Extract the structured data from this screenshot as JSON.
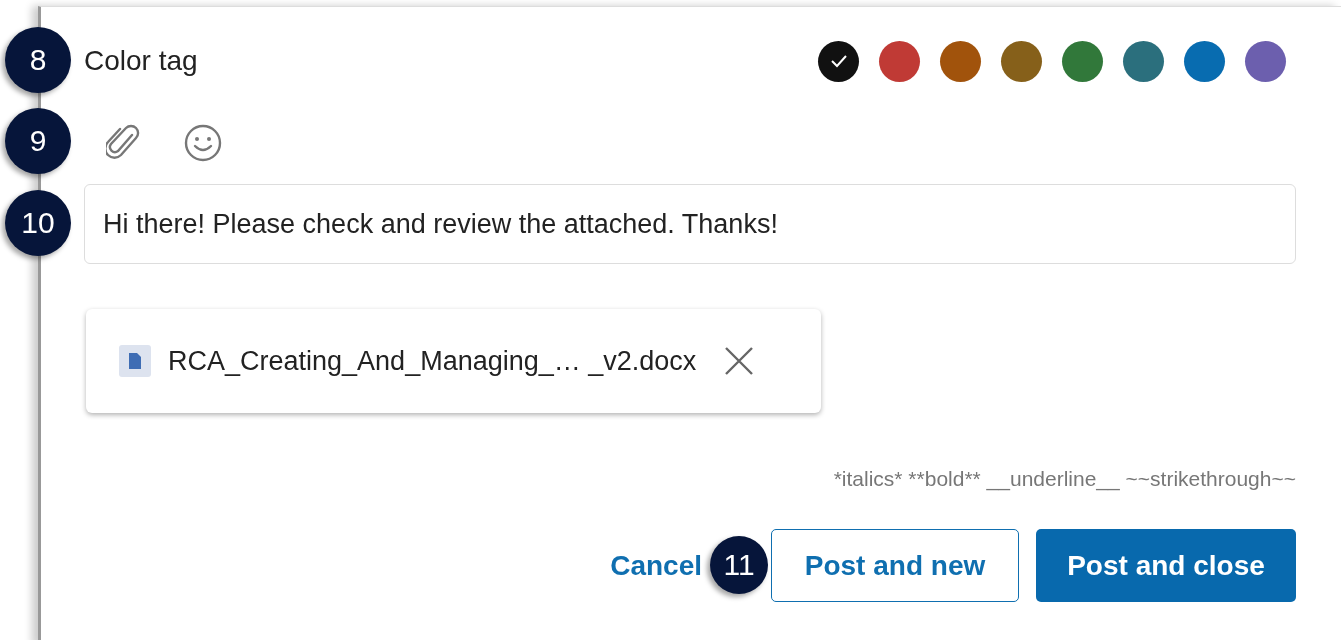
{
  "color_tag": {
    "label": "Color tag",
    "colors": [
      {
        "color": "#111111",
        "selected": true
      },
      {
        "color": "#c03a35",
        "selected": false
      },
      {
        "color": "#a1530c",
        "selected": false
      },
      {
        "color": "#86601a",
        "selected": false
      },
      {
        "color": "#31783a",
        "selected": false
      },
      {
        "color": "#2b6f7d",
        "selected": false
      },
      {
        "color": "#086cb0",
        "selected": false
      },
      {
        "color": "#6c5fae",
        "selected": false
      }
    ]
  },
  "message": {
    "value": "Hi there! Please check and review the attached. Thanks!"
  },
  "attachment": {
    "name": "RCA_Creating_And_Managing_… _v2.docx"
  },
  "format_hint": "*italics* **bold** __underline__ ~~strikethrough~~",
  "buttons": [
    {
      "kind": "link",
      "label": "Cancel"
    },
    {
      "kind": "secondary",
      "label": "Post and new"
    },
    {
      "kind": "primary",
      "label": "Post and close"
    }
  ],
  "callouts": [
    {
      "label": "8"
    },
    {
      "label": "9"
    },
    {
      "label": "10"
    },
    {
      "label": "11"
    }
  ]
}
